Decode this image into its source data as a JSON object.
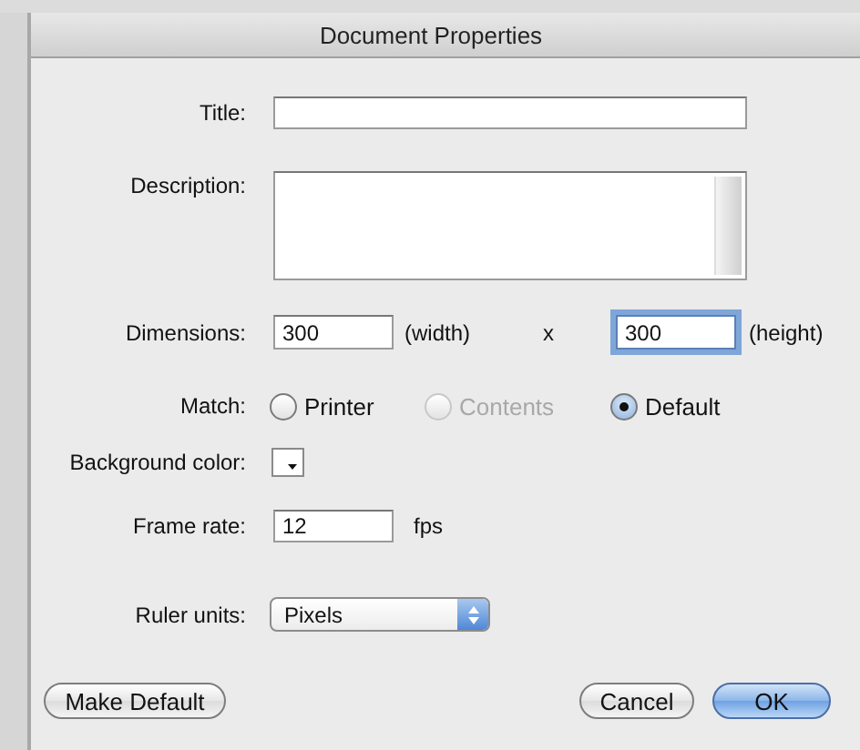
{
  "window": {
    "title": "Document Properties"
  },
  "title_field": {
    "label": "Title:"
  },
  "description_field": {
    "label": "Description:"
  },
  "dimensions": {
    "label": "Dimensions:",
    "width": {
      "value": "300",
      "unit": "(width)",
      "focused": false
    },
    "separator": "x",
    "height": {
      "value": "300",
      "unit": "(height)",
      "focused": true
    }
  },
  "match": {
    "label": "Match:",
    "options": [
      {
        "label": "Printer",
        "selected": false,
        "disabled": false
      },
      {
        "label": "Contents",
        "selected": false,
        "disabled": true
      },
      {
        "label": "Default",
        "selected": true,
        "disabled": false
      }
    ]
  },
  "background_color": {
    "label": "Background color:"
  },
  "frame_rate": {
    "label": "Frame rate:",
    "value": "12",
    "unit": "fps"
  },
  "ruler_units": {
    "label": "Ruler units:",
    "value": "Pixels"
  },
  "buttons": [
    {
      "label": "Make Default",
      "kind": "normal"
    },
    {
      "label": "Cancel",
      "kind": "normal"
    },
    {
      "label": "OK",
      "kind": "default"
    }
  ]
}
